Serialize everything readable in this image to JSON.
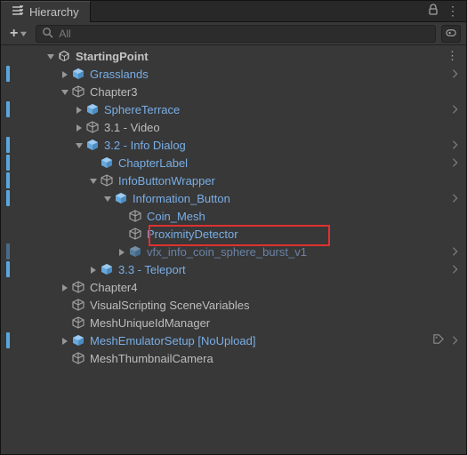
{
  "panel": {
    "title": "Hierarchy"
  },
  "search": {
    "placeholder": "All"
  },
  "tree": {
    "root": "StartingPoint",
    "grasslands": "Grasslands",
    "chapter3": "Chapter3",
    "sphere_terrace": "SphereTerrace",
    "video": "3.1 - Video",
    "info_dialog": "3.2 - Info Dialog",
    "chapter_label": "ChapterLabel",
    "info_btn_wrap": "InfoButtonWrapper",
    "info_btn": "Information_Button",
    "coin_mesh": "Coin_Mesh",
    "proximity": "ProximityDetector",
    "vfx": "vfx_info_coin_sphere_burst_v1",
    "teleport": "3.3 - Teleport",
    "chapter4": "Chapter4",
    "vsv": "VisualScripting SceneVariables",
    "muid": "MeshUniqueIdManager",
    "mes": "MeshEmulatorSetup [NoUpload]",
    "mtc": "MeshThumbnailCamera"
  }
}
